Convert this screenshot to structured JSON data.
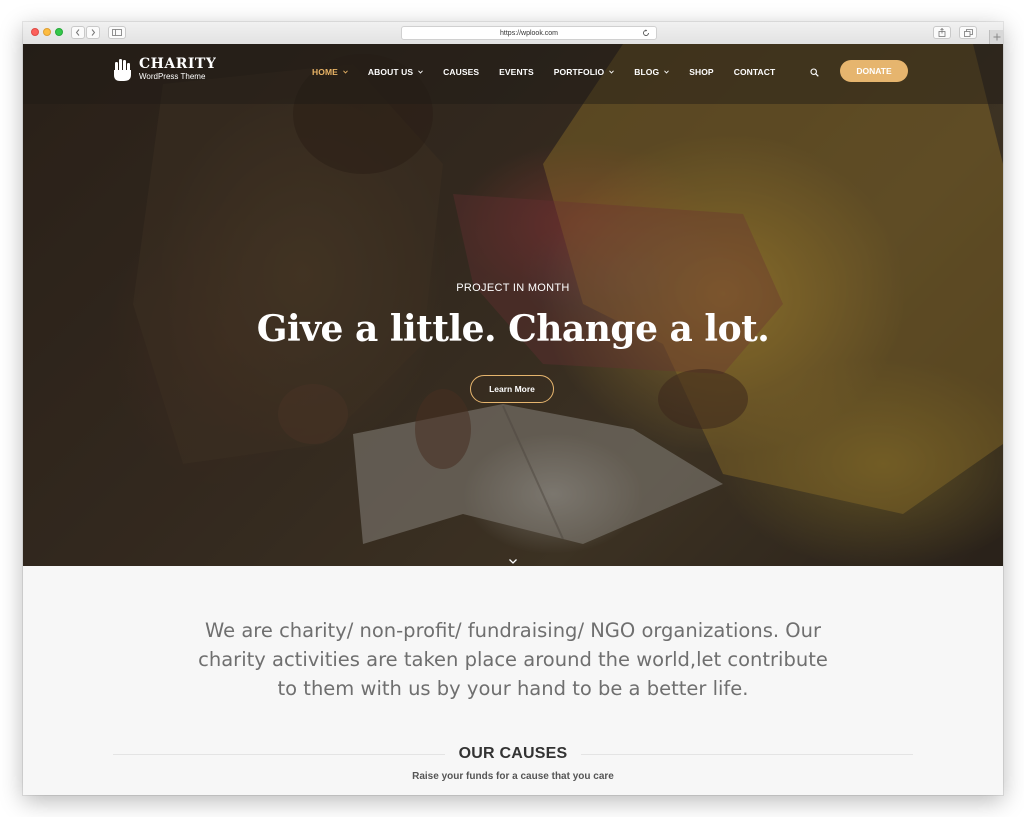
{
  "browser": {
    "url": "https://wplook.com",
    "icons": [
      "back-icon",
      "forward-icon",
      "sidebar-icon",
      "reload-icon",
      "share-icon",
      "tabs-icon",
      "new-tab-icon"
    ]
  },
  "site": {
    "logo_title": "CHARITY",
    "logo_subtitle": "WordPress Theme",
    "nav": [
      {
        "label": "HOME",
        "has_dropdown": true,
        "active": true
      },
      {
        "label": "ABOUT US",
        "has_dropdown": true,
        "active": false
      },
      {
        "label": "CAUSES",
        "has_dropdown": false,
        "active": false
      },
      {
        "label": "EVENTS",
        "has_dropdown": false,
        "active": false
      },
      {
        "label": "PORTFOLIO",
        "has_dropdown": true,
        "active": false
      },
      {
        "label": "BLOG",
        "has_dropdown": true,
        "active": false
      },
      {
        "label": "SHOP",
        "has_dropdown": false,
        "active": false
      },
      {
        "label": "CONTACT",
        "has_dropdown": false,
        "active": false
      }
    ],
    "donate_label": "DONATE",
    "accent_color": "#e6b56e"
  },
  "hero": {
    "kicker": "PROJECT IN MONTH",
    "title": "Give a little. Change a lot.",
    "button_label": "Learn More"
  },
  "intro": {
    "text": "We are charity/ non-profit/ fundraising/ NGO organizations. Our charity activities are taken place around the world,let contribute to them with us by your hand to be a better life."
  },
  "causes": {
    "title": "OUR CAUSES",
    "subtitle": "Raise your funds for a cause that you care"
  }
}
